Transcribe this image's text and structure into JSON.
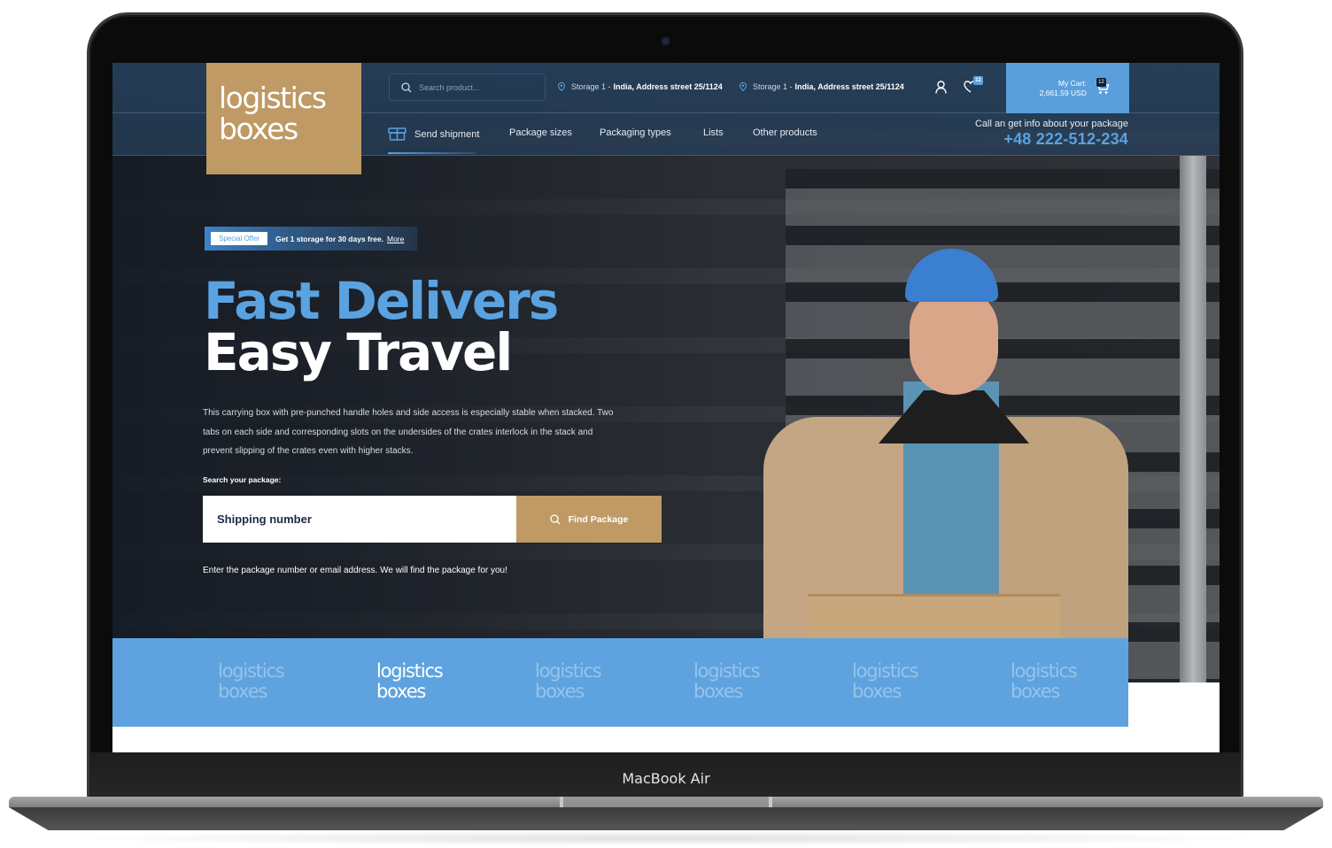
{
  "device": {
    "label": "MacBook Air"
  },
  "header": {
    "logo": {
      "line1": "logistics",
      "line2": "boxes"
    },
    "search": {
      "placeholder": "Search product...",
      "icon": "search-icon"
    },
    "storages": [
      {
        "label": "Storage 1 -",
        "address": "India, Address street 25/1124",
        "icon": "map-pin-icon"
      },
      {
        "label": "Storage 1 -",
        "address": "India, Address street 25/1124",
        "icon": "map-pin-icon"
      }
    ],
    "account_icon": "user-icon",
    "wishlist": {
      "icon": "heart-icon",
      "count": "12"
    },
    "cart": {
      "label": "My Cart:",
      "amount": "2,661.59 USD",
      "count": "12",
      "icon": "cart-icon"
    }
  },
  "nav": {
    "items": [
      {
        "label": "Send shipment",
        "icon": "box-icon",
        "active": true
      },
      {
        "label": "Package sizes"
      },
      {
        "label": "Packaging types"
      },
      {
        "label": "Lists"
      },
      {
        "label": "Other products"
      }
    ],
    "call": {
      "label": "Call an get info about your package",
      "phone": "+48 222-512-234"
    }
  },
  "hero": {
    "offer": {
      "tag": "Special Offer",
      "text": "Get 1 storage for 30 days free.",
      "link": "More"
    },
    "title_line1": "Fast Delivers",
    "title_line2": "Easy Travel",
    "description": "This carrying box with pre-punched handle holes and side access is especially stable when stacked. Two tabs on each side and corresponding slots on the undersides of the crates interlock in the stack and prevent slipping of the crates even with higher stacks.",
    "search_label": "Search your package:",
    "input_placeholder": "Shipping number",
    "button_label": "Find Package",
    "hint": "Enter the package number or email address. We will find the package for you!"
  },
  "colors": {
    "accent_blue": "#5aa2e0",
    "gold": "#bf9a65",
    "navy": "#243e58"
  },
  "brands": [
    {
      "line1": "logistics",
      "line2": "boxes",
      "active": false
    },
    {
      "line1": "logistics",
      "line2": "boxes",
      "active": true
    },
    {
      "line1": "logistics",
      "line2": "boxes",
      "active": false
    },
    {
      "line1": "logistics",
      "line2": "boxes",
      "active": false
    },
    {
      "line1": "logistics",
      "line2": "boxes",
      "active": false
    },
    {
      "line1": "logistics",
      "line2": "boxes",
      "active": false
    }
  ]
}
